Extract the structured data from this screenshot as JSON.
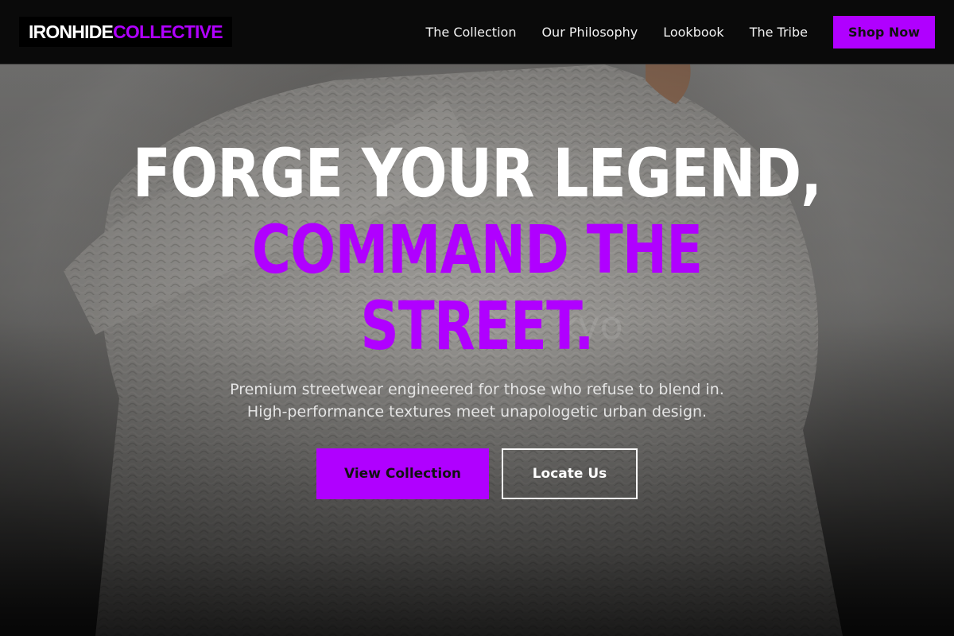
{
  "brand": {
    "part1": "IRONHIDE",
    "part2": "COLLECTIVE",
    "accent_color": "#b000ff"
  },
  "nav": {
    "items": [
      {
        "label": "The Collection"
      },
      {
        "label": "Our Philosophy"
      },
      {
        "label": "Lookbook"
      },
      {
        "label": "The Tribe"
      }
    ],
    "cta_label": "Shop Now"
  },
  "hero": {
    "headline_line1": "FORGE YOUR LEGEND,",
    "headline_line2": "COMMAND THE",
    "headline_line3": "STREET.",
    "subtitle_line1": "Premium streetwear engineered for those who refuse to blend in.",
    "subtitle_line2": "High-performance textures meet unapologetic urban design.",
    "primary_button": "View Collection",
    "secondary_button": "Locate Us",
    "background_image": "knit-sweater-photo"
  }
}
